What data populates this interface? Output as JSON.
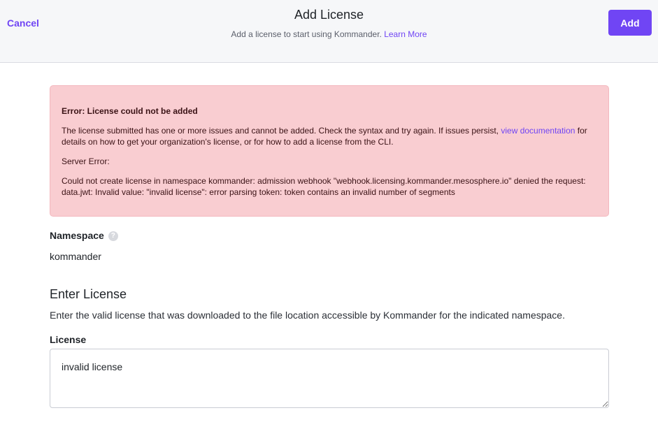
{
  "header": {
    "cancel_label": "Cancel",
    "title": "Add License",
    "subtitle_text": "Add a license to start using Kommander.",
    "learn_more_label": "Learn More",
    "add_label": "Add"
  },
  "error": {
    "title": "Error: License could not be added",
    "message_part1": "The license submitted has one or more issues and cannot be added. Check the syntax and try again. If issues persist,",
    "message_link": "view documentation",
    "message_part2": "for details on how to get your organization's license, or for how to add a license from the CLI.",
    "server_error_label": "Server Error:",
    "server_error_detail": "Could not create license in namespace kommander: admission webhook \"webhook.licensing.kommander.mesosphere.io\" denied the request: data.jwt: Invalid value: \"invalid license\": error parsing token: token contains an invalid number of segments"
  },
  "namespace": {
    "label": "Namespace",
    "help_icon": "question-circle-icon",
    "value": "kommander"
  },
  "enter_license": {
    "title": "Enter License",
    "description": "Enter the valid license that was downloaded to the file location accessible by Kommander for the indicated namespace.",
    "field_label": "License",
    "field_value": "invalid license"
  },
  "colors": {
    "accent": "#7045f4",
    "error_bg": "#f9cdd1",
    "header_bg": "#f6f7f9"
  }
}
